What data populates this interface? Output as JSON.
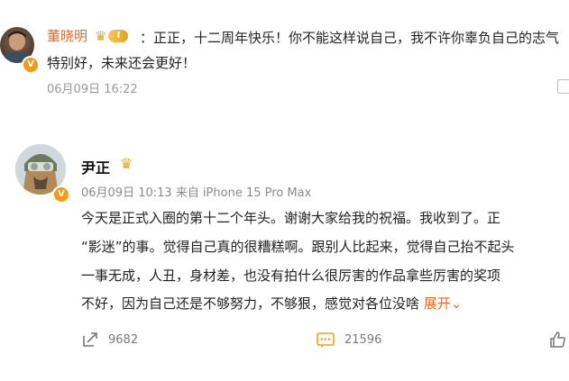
{
  "reply": {
    "author": "董晓明",
    "level": "I",
    "text_line1": "：正正，十二周年快乐！你不能这样说自己，我不许你辜负自己的志气",
    "text_line2": "特别好，未来还会更好！",
    "time": "06月09日 16:22"
  },
  "post": {
    "author": "尹正",
    "meta": "06月09日 10:13  来自 iPhone 15 Pro Max",
    "lines": [
      "今天是正式入圈的第十二个年头。谢谢大家给我的祝福。我收到了。正",
      "“影迷”的事。觉得自己真的很糟糕啊。跟别人比起来，觉得自己抬不起头",
      "一事无成，人丑，身材差，也没有拍什么很厉害的作品拿些厉害的奖项",
      "不好，因为自己还是不够努力，不够狠，感觉对各位没啥"
    ],
    "more_label": "展开",
    "more_chevron": "⌄",
    "reposts": "9682",
    "comments": "21596"
  },
  "colors": {
    "accent": "#e86a22",
    "verified": "#f39a1a",
    "crown": "#e2a523"
  },
  "icons": {
    "repost": "share-icon",
    "comment": "comment-icon",
    "like": "thumbs-up-icon",
    "crown": "crown-icon",
    "verified": "verified-v-icon"
  }
}
